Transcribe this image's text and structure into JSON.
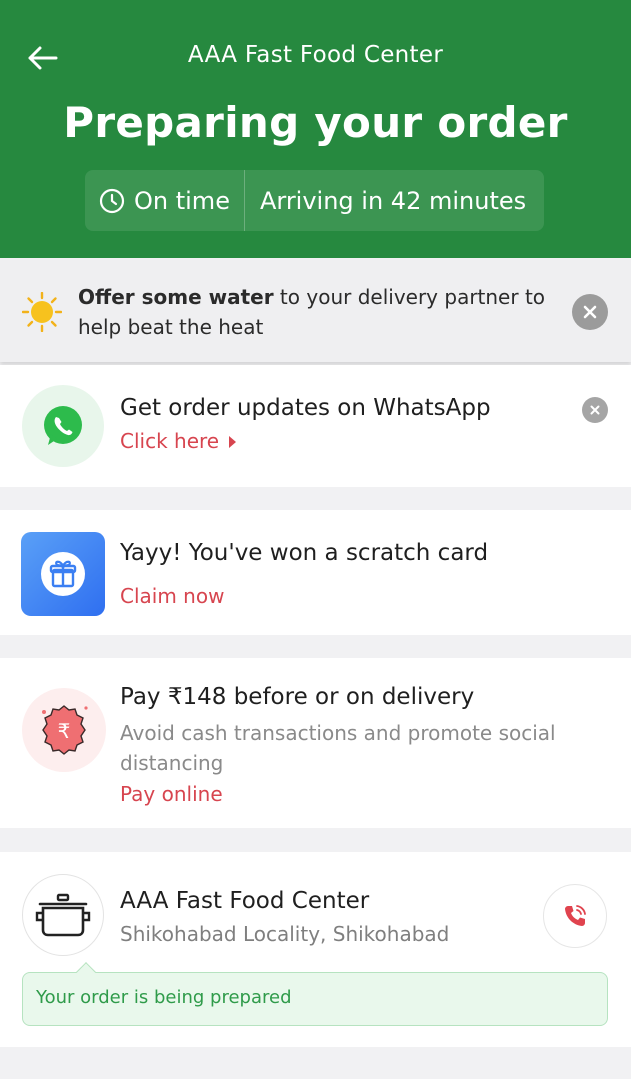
{
  "header": {
    "back_icon": "arrow-left-icon",
    "restaurant_name": "AAA Fast Food Center",
    "status_title": "Preparing your order",
    "eta": {
      "clock_icon": "clock-icon",
      "on_time_label": "On time",
      "arriving_label": "Arriving in 42 minutes"
    },
    "background_color": "#26893f"
  },
  "heat_banner": {
    "icon": "sun-icon",
    "bold_text": "Offer some water",
    "text": " to your delivery partner to help beat the heat",
    "close_icon": "close-icon"
  },
  "whatsapp_card": {
    "icon": "whatsapp-icon",
    "title": "Get order updates on WhatsApp",
    "link_label": "Click here",
    "link_icon": "caret-right-icon",
    "close_icon": "close-icon"
  },
  "scratch_card": {
    "icon": "gift-icon",
    "title": "Yayy! You've won a scratch card",
    "link_label": "Claim now"
  },
  "payment_card": {
    "icon": "rupee-badge-icon",
    "title": "Pay ₹148 before or on delivery",
    "subtitle": "Avoid cash transactions and promote social distancing",
    "link_label": "Pay online"
  },
  "restaurant_card": {
    "icon": "cooking-pot-icon",
    "name": "AAA Fast Food Center",
    "locality": "Shikohabad Locality, Shikohabad",
    "call_icon": "phone-call-icon",
    "status_text": "Your order is being prepared"
  },
  "colors": {
    "accent_red": "#d7454f",
    "status_green": "#2f9b4a"
  }
}
